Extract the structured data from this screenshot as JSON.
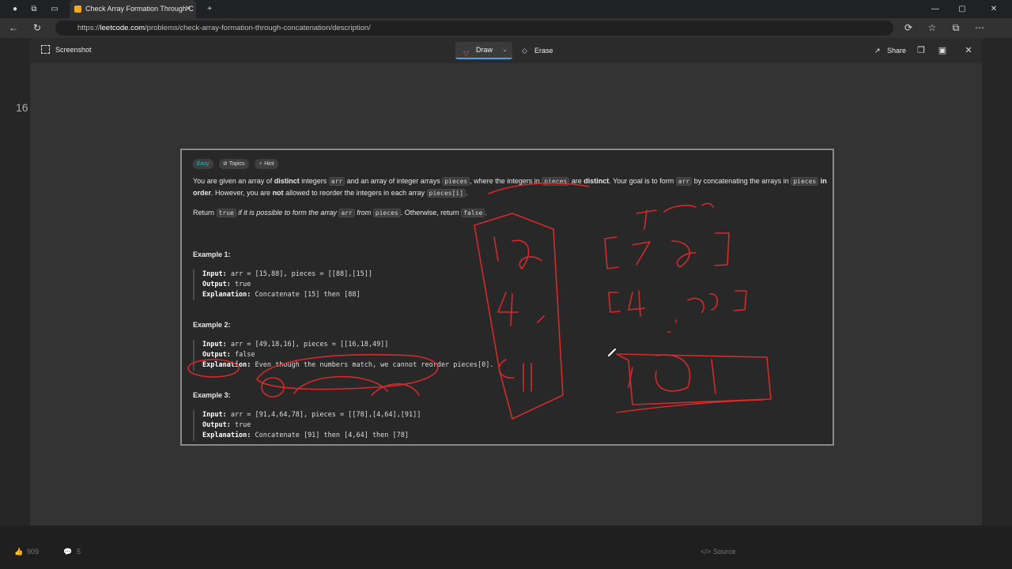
{
  "browser": {
    "tab_title": "Check Array Formation Through C",
    "url_domain": "leetcode.com",
    "url_prefix": "https://",
    "url_path": "/problems/check-array-formation-through-concatenation/description/"
  },
  "overlay": {
    "title": "Screenshot",
    "draw_label": "Draw",
    "erase_label": "Erase",
    "share_label": "Share"
  },
  "problem": {
    "difficulty": "Easy",
    "topics_label": "Topics",
    "hint_label": "Hint",
    "para1": {
      "t1": "You are given an array of ",
      "b1": "distinct",
      "t2": " integers ",
      "c1": "arr",
      "t3": " and an array of integer arrays ",
      "c2": "pieces",
      "t4": ", where the integers in ",
      "c3": "pieces",
      "t5": " are ",
      "b2": "distinct",
      "t6": ". Your goal is to form ",
      "c4": "arr",
      "t7": " by concatenating the arrays in ",
      "c5": "pieces",
      "t8": " ",
      "b3": "in order",
      "t9": ". However, you are ",
      "b4": "not",
      "t10": " allowed to reorder the integers in each array ",
      "c6": "pieces[i]",
      "t11": "."
    },
    "para2": {
      "t1": "Return ",
      "c1": "true",
      "i1": " if it is possible to form the array ",
      "c2": "arr",
      "i2": " from ",
      "c3": "pieces",
      "t2": ". Otherwise, return ",
      "c4": "false",
      "t3": "."
    },
    "examples": [
      {
        "title": "Example 1:",
        "input_label": "Input:",
        "input": " arr = [15,88], pieces = [[88],[15]]",
        "output_label": "Output:",
        "output": " true",
        "expl_label": "Explanation:",
        "expl": " Concatenate [15] then [88]"
      },
      {
        "title": "Example 2:",
        "input_label": "Input:",
        "input": " arr = [49,18,16], pieces = [[16,18,49]]",
        "output_label": "Output:",
        "output": " false",
        "expl_label": "Explanation:",
        "expl": " Even though the numbers match, we cannot reorder pieces[0]."
      },
      {
        "title": "Example 3:",
        "input_label": "Input:",
        "input": " arr = [91,4,64,78], pieces = [[78],[4,64],[91]]",
        "output_label": "Output:",
        "output": " true",
        "expl_label": "Explanation:",
        "expl": " Concatenate [91] then [4,64] then [78]"
      }
    ]
  },
  "page_behind": {
    "likes": "909",
    "comments": "5",
    "source_label": "Source"
  },
  "colors": {
    "ink": "#d42a2a",
    "easy": "#2fb8a8",
    "accent": "#4aa3f0"
  }
}
